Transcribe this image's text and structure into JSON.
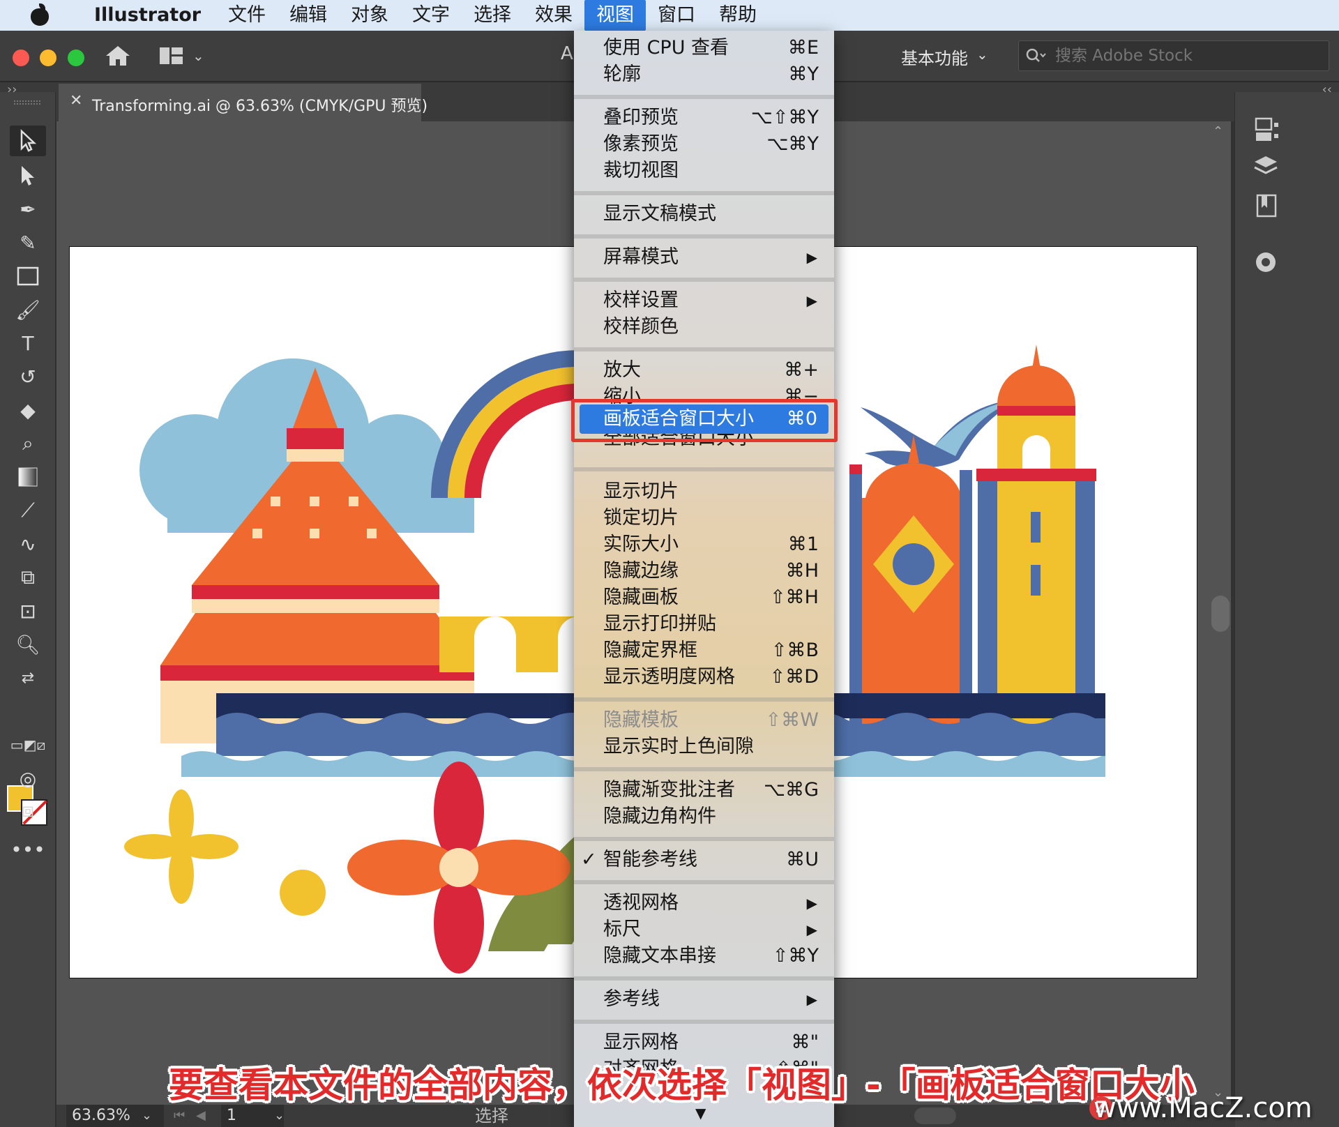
{
  "menubar": {
    "app_name": "Illustrator",
    "items": [
      "文件",
      "编辑",
      "对象",
      "文字",
      "选择",
      "效果",
      "视图",
      "窗口",
      "帮助"
    ],
    "active_item": "视图"
  },
  "toolbar": {
    "workspace": "基本功能",
    "search_placeholder": "搜索 Adobe Stock",
    "cut_letter": "A"
  },
  "document": {
    "tab_title": "Transforming.ai @ 63.63% (CMYK/GPU 预览)"
  },
  "view_menu": {
    "items": [
      {
        "label": "使用 CPU 查看",
        "shortcut": "⌘E"
      },
      {
        "label": "轮廓",
        "shortcut": "⌘Y"
      },
      {
        "label": "叠印预览",
        "shortcut": "⌥⇧⌘Y"
      },
      {
        "label": "像素预览",
        "shortcut": "⌥⌘Y"
      },
      {
        "label": "裁切视图",
        "shortcut": ""
      },
      {
        "label": "显示文稿模式",
        "shortcut": ""
      },
      {
        "label": "屏幕模式",
        "shortcut": "",
        "submenu": true
      },
      {
        "label": "校样设置",
        "shortcut": "",
        "submenu": true
      },
      {
        "label": "校样颜色",
        "shortcut": ""
      },
      {
        "label": "放大",
        "shortcut": "⌘+"
      },
      {
        "label": "缩小",
        "shortcut": "⌘−"
      },
      {
        "label": "画板适合窗口大小",
        "shortcut": "⌘0",
        "highlighted": true
      },
      {
        "label": "全部适合窗口大小",
        "shortcut": ""
      },
      {
        "label": "显示切片",
        "shortcut": ""
      },
      {
        "label": "锁定切片",
        "shortcut": ""
      },
      {
        "label": "实际大小",
        "shortcut": "⌘1"
      },
      {
        "label": "隐藏边缘",
        "shortcut": "⌘H"
      },
      {
        "label": "隐藏画板",
        "shortcut": "⇧⌘H"
      },
      {
        "label": "显示打印拼贴",
        "shortcut": ""
      },
      {
        "label": "隐藏定界框",
        "shortcut": "⇧⌘B"
      },
      {
        "label": "显示透明度网格",
        "shortcut": "⇧⌘D"
      },
      {
        "label": "隐藏模板",
        "shortcut": "⇧⌘W",
        "disabled": true
      },
      {
        "label": "显示实时上色间隙",
        "shortcut": ""
      },
      {
        "label": "隐藏渐变批注者",
        "shortcut": "⌥⌘G"
      },
      {
        "label": "隐藏边角构件",
        "shortcut": ""
      },
      {
        "label": "智能参考线",
        "shortcut": "⌘U",
        "checked": true
      },
      {
        "label": "透视网格",
        "shortcut": "",
        "submenu": true
      },
      {
        "label": "标尺",
        "shortcut": "",
        "submenu": true
      },
      {
        "label": "隐藏文本串接",
        "shortcut": "⇧⌘Y"
      },
      {
        "label": "参考线",
        "shortcut": "",
        "submenu": true
      },
      {
        "label": "显示网格",
        "shortcut": "⌘\""
      },
      {
        "label": "对齐网格",
        "shortcut": "⇧⌘\""
      }
    ],
    "check_mark": "✓",
    "submenu_arrow": "▶",
    "more_arrow": "▼"
  },
  "statusbar": {
    "zoom": "63.63%",
    "page": "1",
    "tool": "选择"
  },
  "caption": "要查看本文件的全部内容，依次选择「视图」-「画板适合窗口大小",
  "watermark": "www.MacZ.com",
  "watermark_logo": "Z",
  "colors": {
    "menu_highlight": "#2d7be0",
    "callout_red": "#e4382e",
    "orange": "#f0692e",
    "red": "#d9263b",
    "yellow": "#f2c12e",
    "navy": "#1e2c5a",
    "blue": "#4f6ea8",
    "sky": "#8fc1da",
    "cream": "#fbdfb0",
    "olive": "#7f8b3e"
  },
  "icons": [
    "apple-icon",
    "home-icon",
    "layout-icon",
    "search-icon",
    "close-icon",
    "selection-tool-icon",
    "direct-selection-icon",
    "pen-icon",
    "curvature-icon",
    "rectangle-icon",
    "brush-icon",
    "type-icon",
    "rotate-icon",
    "eraser-icon",
    "lasso-icon",
    "gradient-icon",
    "eyedropper-icon",
    "blend-icon",
    "shape-builder-icon",
    "artboard-icon",
    "zoom-icon",
    "libraries-icon",
    "layers-icon",
    "properties-icon",
    "color-guide-icon"
  ]
}
